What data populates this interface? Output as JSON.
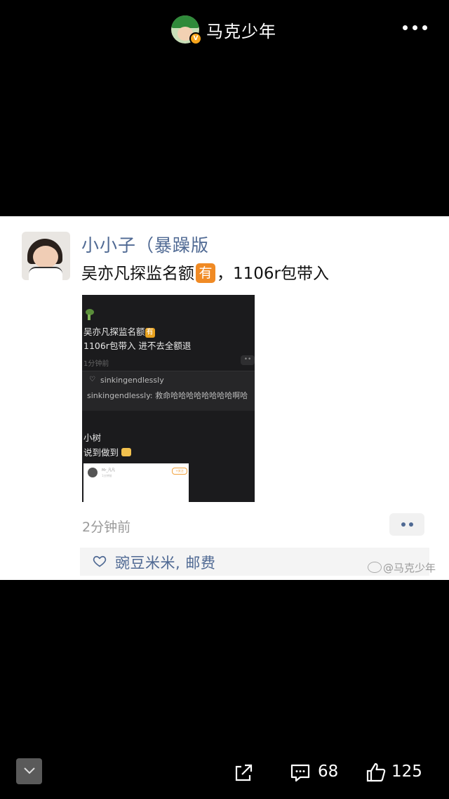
{
  "header": {
    "title": "马克少年",
    "badge": "V"
  },
  "post": {
    "username": "小小子（暴躁版",
    "text_before": "吴亦凡探监名额",
    "tag": "有",
    "text_after": "，1106r包带入",
    "image": {
      "line1": "吴亦凡探监名额",
      "tag": "有",
      "line2": "1106r包带入 进不去全额退",
      "time": "1分钟前",
      "like_name": "sinkingendlessly",
      "comment": "sinkingendlessly: 救命哈哈哈哈哈哈哈哈啊哈",
      "reply_name": "小树",
      "reply_text": "说到做到"
    },
    "time": "2分钟前",
    "likers": "豌豆米米, 邮费"
  },
  "watermark": "@马克少年",
  "bottom": {
    "comments": "68",
    "likes": "125"
  }
}
